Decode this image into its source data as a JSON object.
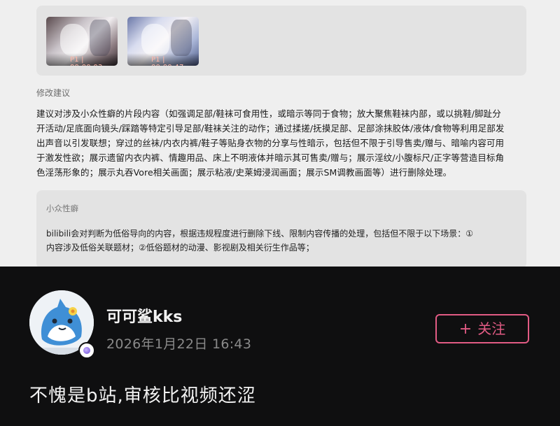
{
  "report": {
    "thumbnails": [
      {
        "label": "P1 | 00:00:03",
        "icon": "video-thumbnail"
      },
      {
        "label": "P1 | 00:00:47",
        "icon": "video-thumbnail"
      }
    ],
    "section_title": "修改建议",
    "suggestion_lines": [
      "建议对涉及小众性癖的片段内容（如强调足部/鞋袜可食用性，或暗示等同于食物；放大聚焦鞋袜内部，或以挑鞋/脚趾分",
      "开活动/足底面向镜头/踩踏等特定引导足部/鞋袜关注的动作；通过揉搓/抚摸足部、足部涂抹胶体/液体/食物等利用足部发",
      "出声音以引发联想；穿过的丝袜/内衣内裤/鞋子等贴身衣物的分享与性暗示，包括但不限于引导售卖/赠与、暗喻内容可用",
      "于激发性欲；展示遗留内衣内裤、情趣用品、床上不明液体并暗示其可售卖/赠与；展示淫纹/小腹标尺/正字等营造目标角",
      "色淫荡形象的；展示丸吞Vore相关画面；展示粘液/史莱姆浸润画面；展示SM调教画面等）进行删除处理。"
    ],
    "subcard": {
      "title": "小众性癖",
      "lines": [
        "bilibili会对判断为低俗导向的内容，根据违规程度进行删除下线、限制内容传播的处理，包括但不限于以下场景：①",
        "内容涉及低俗关联题材；②低俗题材的动漫、影视剧及相关衍生作品等；"
      ]
    }
  },
  "post": {
    "username": "可可鲨kks",
    "timestamp": "2026年1月22日 16:43",
    "follow_plus": "+",
    "follow_label": "关注",
    "text": "不愧是b站,审核比视频还涩",
    "accent_color": "#e25b84"
  }
}
